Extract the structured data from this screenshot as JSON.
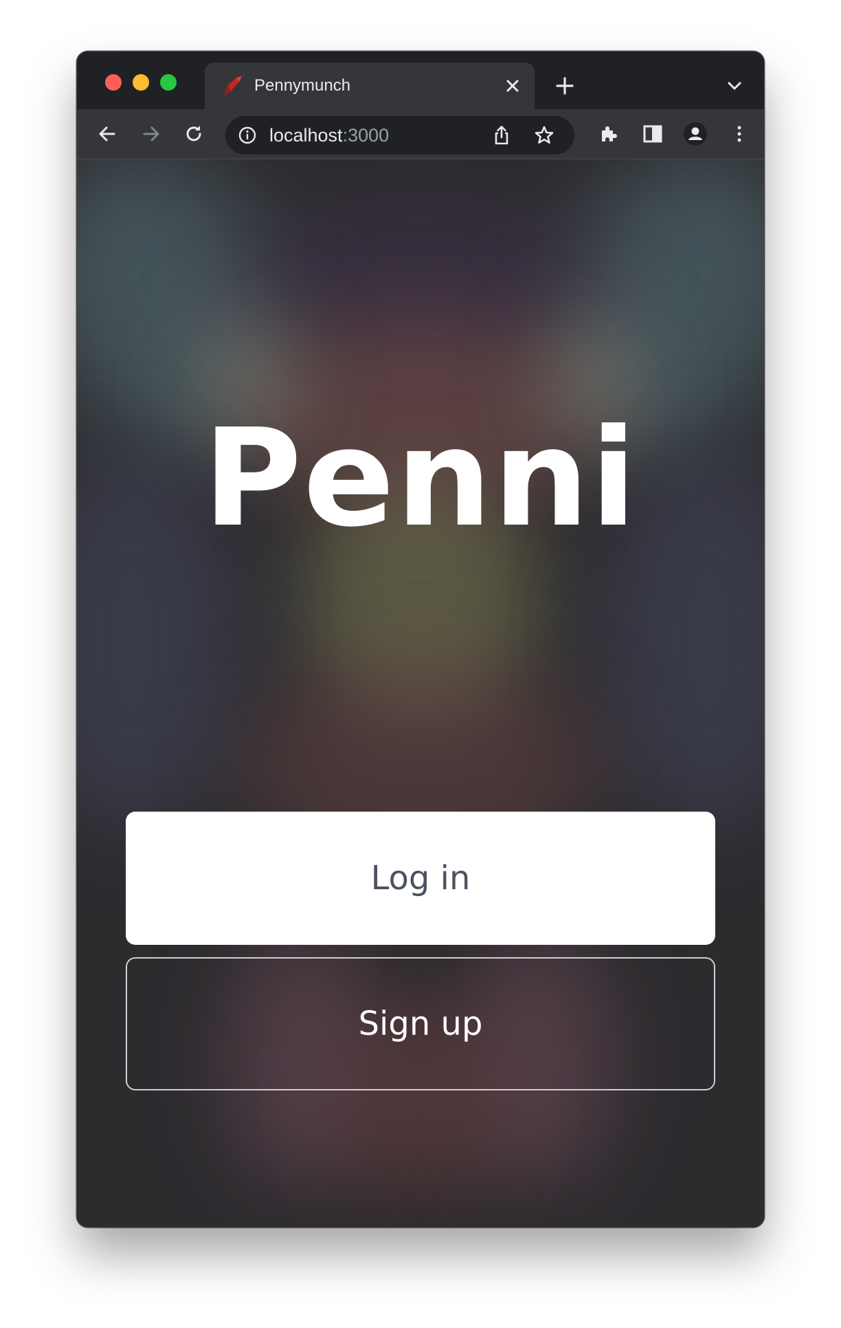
{
  "browser": {
    "tab": {
      "title": "Pennymunch",
      "favicon": "ruby-gem-icon"
    },
    "address_bar": {
      "host": "localhost",
      "port": ":3000"
    }
  },
  "page": {
    "brand_title": "Penni",
    "login_label": "Log in",
    "signup_label": "Sign up"
  },
  "colors": {
    "traffic_red": "#ff5f57",
    "traffic_yellow": "#febc2e",
    "traffic_green": "#28c840",
    "chrome_dark": "#202124",
    "chrome_tab": "#35363a",
    "login_button_bg": "#ffffff",
    "login_button_text": "#4b5261"
  }
}
